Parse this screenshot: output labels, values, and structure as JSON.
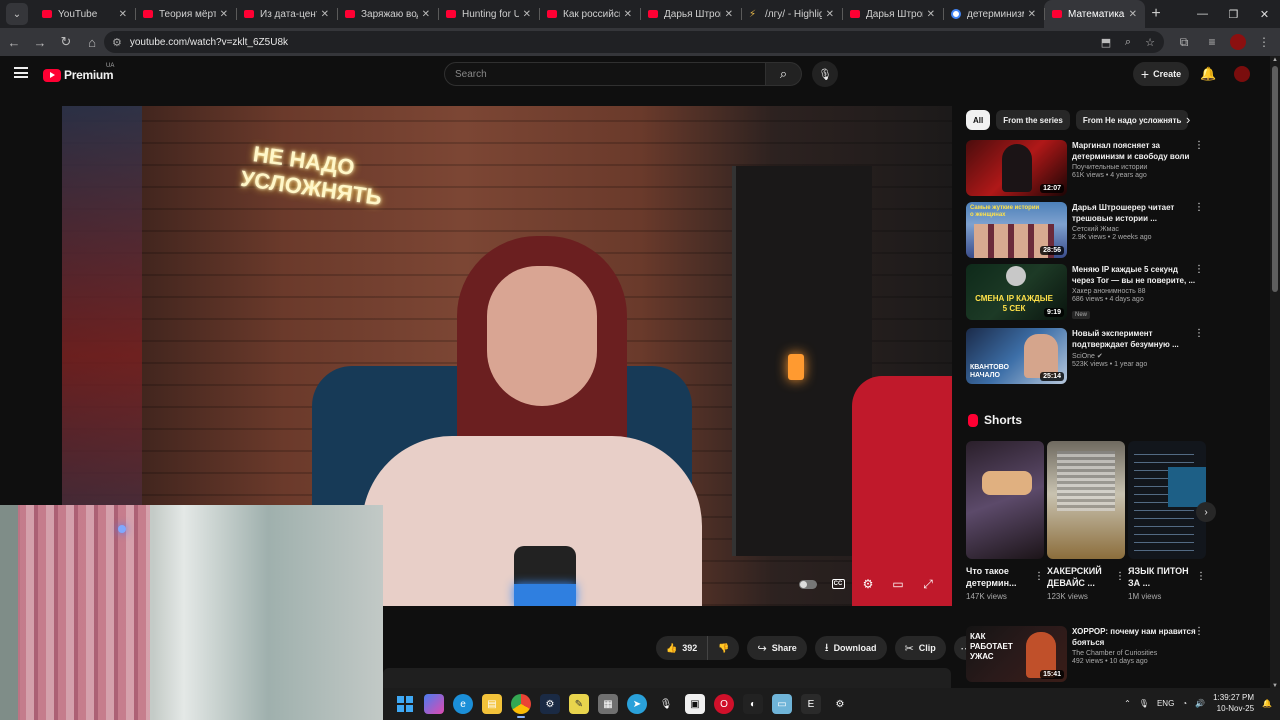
{
  "browser": {
    "tabs": [
      {
        "title": "YouTube",
        "icon": "youtube-icon",
        "active": false
      },
      {
        "title": "Теория мёртв",
        "icon": "youtube-icon",
        "active": false
      },
      {
        "title": "Из дата-центр",
        "icon": "youtube-icon",
        "active": false
      },
      {
        "title": "Заряжаю водо",
        "icon": "youtube-icon",
        "active": false
      },
      {
        "title": "Hunting for UE",
        "icon": "youtube-icon",
        "active": false
      },
      {
        "title": "Как российск",
        "icon": "youtube-icon",
        "active": false
      },
      {
        "title": "Дарья Штроше",
        "icon": "youtube-icon",
        "active": false
      },
      {
        "title": "/лгу/ - Highligh",
        "icon": "highlight-icon",
        "active": false
      },
      {
        "title": "Дарья Штрош",
        "icon": "youtube-icon",
        "active": false
      },
      {
        "title": "детерминизм",
        "icon": "google-icon",
        "active": false
      },
      {
        "title": "Математика и",
        "icon": "youtube-icon",
        "active": true
      }
    ],
    "url": "youtube.com/watch?v=zklt_6Z5U8k"
  },
  "header": {
    "logo_text": "Premium",
    "country_code": "UA",
    "search_placeholder": "Search",
    "create_label": "Create"
  },
  "video": {
    "neon_sign": "НЕ НАДО УСЛОЖНЯТЬ"
  },
  "actions": {
    "like_count": "392",
    "share_label": "Share",
    "download_label": "Download",
    "clip_label": "Clip"
  },
  "chips": [
    {
      "label": "All",
      "active": true
    },
    {
      "label": "From the series",
      "active": false
    },
    {
      "label": "From Не надо усложнять",
      "active": false
    }
  ],
  "recommendations": [
    {
      "title": "Маргинал поясняет за детерминизм и свободу воли",
      "channel": "Поучительные истории",
      "meta": "61K views • 4 years ago",
      "duration": "12:07",
      "badge": ""
    },
    {
      "title": "Дарья Штрошерер читает трешовые истории ...",
      "channel": "Сетский Жмас",
      "meta": "2.9K views • 2 weeks ago",
      "duration": "28:56",
      "badge": ""
    },
    {
      "title": "Меняю IP каждые 5 секунд через Tor — вы не поверите, ...",
      "channel": "Хакер анонимность 88",
      "meta": "686 views • 4 days ago",
      "duration": "9:19",
      "badge": "New"
    },
    {
      "title": "Новый эксперимент подтверждает безумную ...",
      "channel": "SciOne",
      "meta": "523K views • 1 year ago",
      "duration": "25:14",
      "badge": ""
    }
  ],
  "shorts": {
    "heading": "Shorts",
    "items": [
      {
        "title": "Что такое детермин...",
        "views": "147K views"
      },
      {
        "title": "ХАКЕРСКИЙ ДЕВАЙС ...",
        "views": "123K views"
      },
      {
        "title": "ЯЗЫК ПИТОН ЗА ...",
        "views": "1M views"
      }
    ]
  },
  "recommendation_after_shorts": {
    "title": "ХОРРОР: почему нам нравится бояться",
    "channel": "The Chamber of Curiosities",
    "meta": "492 views • 10 days ago",
    "duration": "15:41",
    "thumb_text": "КАК РАБОТАЕТ УЖАС"
  },
  "thumb_texts": {
    "rec2": "Самые жуткие истории о женщинах",
    "rec3": "СМЕНА IP КАЖДЫЕ 5 СЕК",
    "rec4": "КВАНТОВО НАЧАЛО"
  },
  "taskbar": {
    "lang": "ENG",
    "time": "1:39:27 PM",
    "date": "10-Nov-25"
  },
  "colors": {
    "yt_red": "#ff0033",
    "background": "#0f0f0f",
    "chip_bg": "#272727"
  }
}
